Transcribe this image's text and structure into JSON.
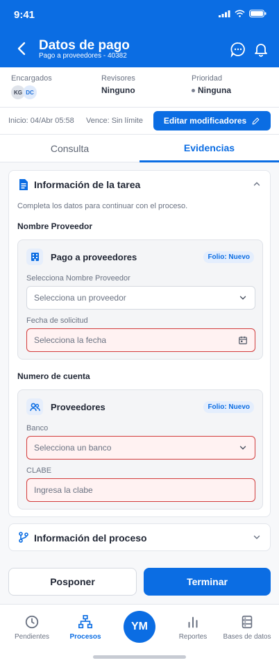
{
  "status_bar": {
    "time": "9:41"
  },
  "header": {
    "title": "Datos de pago",
    "subtitle": "Pago a proveedores - 40382"
  },
  "info": {
    "encargados_label": "Encargados",
    "encargados": [
      "KG",
      "DC"
    ],
    "revisores_label": "Revisores",
    "revisores_value": "Ninguno",
    "prioridad_label": "Prioridad",
    "prioridad_value": "Ninguna"
  },
  "dates": {
    "inicio": "Inicio: 04/Abr 05:58",
    "vence": "Vence: Sin límite",
    "edit_label": "Editar modificadores"
  },
  "tabs": [
    {
      "label": "Consulta",
      "active": false
    },
    {
      "label": "Evidencias",
      "active": true
    }
  ],
  "task_card": {
    "title": "Información de la tarea",
    "helper": "Completa los datos para continuar con el proceso.",
    "section1_label": "Nombre Proveedor",
    "group1": {
      "title": "Pago a proveedores",
      "folio": "Folio: Nuevo",
      "field1_label": "Selecciona Nombre Proveedor",
      "field1_placeholder": "Selecciona un proveedor",
      "field2_label": "Fecha de solicitud",
      "field2_placeholder": "Selecciona la fecha"
    },
    "section2_label": "Numero de cuenta",
    "group2": {
      "title": "Proveedores",
      "folio": "Folio: Nuevo",
      "field1_label": "Banco",
      "field1_placeholder": "Selecciona un banco",
      "field2_label": "CLABE",
      "field2_placeholder": "Ingresa la clabe"
    }
  },
  "process_card": {
    "title": "Información del proceso"
  },
  "actions": {
    "secondary": "Posponer",
    "primary": "Terminar"
  },
  "bottom_nav": {
    "items": [
      {
        "label": "Pendientes",
        "icon": "clock-icon"
      },
      {
        "label": "Procesos",
        "icon": "org-chart-icon"
      },
      {
        "label": "Reportes",
        "icon": "bar-chart-icon"
      },
      {
        "label": "Bases de datos",
        "icon": "database-icon"
      }
    ],
    "fab_initials": "YM"
  },
  "colors": {
    "primary": "#0b6de3",
    "error": "#d23b3b"
  }
}
